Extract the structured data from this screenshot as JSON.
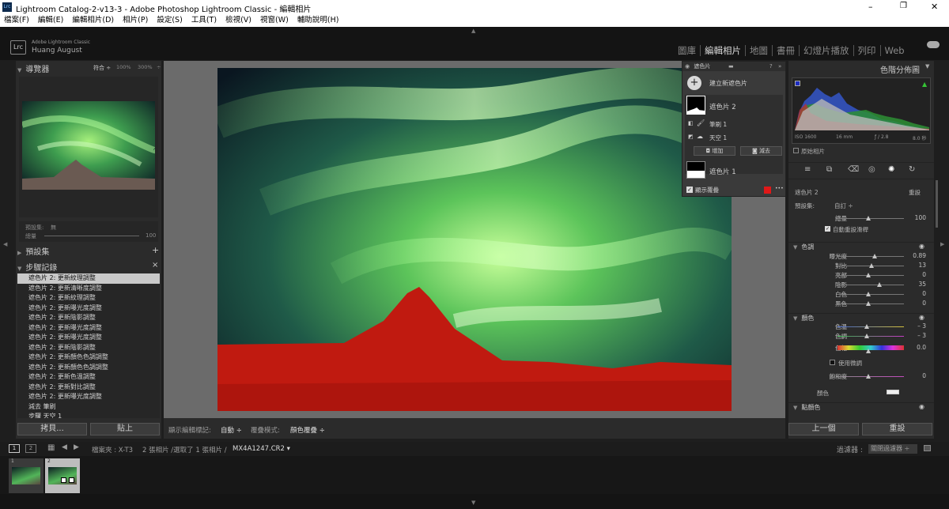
{
  "window": {
    "title": "Lightroom Catalog-2-v13-3 - Adobe Photoshop Lightroom Classic - 編輯相片",
    "icon": "Lrc",
    "controls": [
      "–",
      "❐",
      "✕"
    ]
  },
  "menu": [
    "檔案(F)",
    "編輯(E)",
    "編輯相片(D)",
    "相片(P)",
    "設定(S)",
    "工具(T)",
    "檢視(V)",
    "視窗(W)",
    "輔助說明(H)"
  ],
  "identity": {
    "badge": "Lrc",
    "product": "Adobe Lightroom Classic",
    "user": "Huang August"
  },
  "modules": [
    {
      "label": "圖庫",
      "active": false
    },
    {
      "label": "編輯相片",
      "active": true
    },
    {
      "label": "地圖",
      "active": false
    },
    {
      "label": "書冊",
      "active": false
    },
    {
      "label": "幻燈片播放",
      "active": false
    },
    {
      "label": "列印",
      "active": false
    },
    {
      "label": "Web",
      "active": false
    }
  ],
  "navigator": {
    "title": "導覽器",
    "zoom_fit": "符合 ÷",
    "zoom_100": "100%",
    "zoom_300": "300%"
  },
  "preset_preview": {
    "label": "預設集:",
    "value": "無",
    "amount_label": "總量",
    "amount_value": "100"
  },
  "presets": {
    "title": "預設集",
    "add": "+"
  },
  "history": {
    "title": "步驟記錄",
    "close": "×",
    "items": [
      "遮色片 2: 更新紋理調整",
      "遮色片 2: 更新清晰度調整",
      "遮色片 2: 更新紋理調整",
      "遮色片 2: 更新曝光度調整",
      "遮色片 2: 更新陰影調整",
      "遮色片 2: 更新曝光度調整",
      "遮色片 2: 更新曝光度調整",
      "遮色片 2: 更新陰影調整",
      "遮色片 2: 更新顏色色調調整",
      "遮色片 2: 更新顏色色調調整",
      "遮色片 2: 更新色溫調整",
      "遮色片 2: 更新對比調整",
      "遮色片 2: 更新曝光度調整",
      "減去 筆刷",
      "步驟 天空 1"
    ]
  },
  "left_buttons": {
    "copy": "拷貝...",
    "paste": "貼上"
  },
  "toolbar": {
    "show_label": "顯示編輯標記:",
    "show_value": "自動 ÷",
    "overlay_label": "覆疊模式:",
    "overlay_value": "顏色覆疊 ÷"
  },
  "mask_panel": {
    "title": "遮色片",
    "create": "建立新遮色片",
    "mask2": "遮色片 2",
    "brush": "筆刷 1",
    "sky": "天空 1",
    "add": "增加",
    "subtract": "減去",
    "mask1": "遮色片 1",
    "show_overlay": "顯示覆疊",
    "overlay_color": "#e01818",
    "more": "•••"
  },
  "histogram": {
    "title": "色階分佈圖",
    "iso": "ISO 1600",
    "focal": "16 mm",
    "aperture": "ƒ / 2.8",
    "shutter": "8.0 秒",
    "original": "原始相片"
  },
  "tools": [
    "sliders-icon",
    "crop-icon",
    "heal-icon",
    "redeye-icon",
    "mask-icon",
    "reset-icon"
  ],
  "mask_edit": {
    "name": "遮色片 2",
    "reset": "重設",
    "preset_label": "預設集:",
    "preset_value": "自訂 ÷",
    "amount_label": "總量",
    "amount_value": "100",
    "auto_reset": "自動重設滑桿"
  },
  "tone": {
    "title": "色調",
    "sliders": [
      {
        "label": "曝光度",
        "value": "0.89",
        "pos": 0.6
      },
      {
        "label": "對比",
        "value": "13",
        "pos": 0.56
      },
      {
        "label": "亮部",
        "value": "0",
        "pos": 0.5
      },
      {
        "label": "陰影",
        "value": "35",
        "pos": 0.67
      },
      {
        "label": "白色",
        "value": "0",
        "pos": 0.5
      },
      {
        "label": "黑色",
        "value": "0",
        "pos": 0.5
      }
    ]
  },
  "color": {
    "title": "顏色",
    "sliders": [
      {
        "label": "色溫",
        "value": "– 3",
        "pos": 0.48
      },
      {
        "label": "色調",
        "value": "– 3",
        "pos": 0.48
      },
      {
        "label": "色相",
        "value": "0.0",
        "pos": 0.5
      }
    ],
    "fine": "使用微調",
    "saturation_label": "飽和度",
    "saturation_value": "0",
    "color_label": "顏色"
  },
  "detail": {
    "title": "點顏色"
  },
  "right_buttons": {
    "prev": "上一個",
    "reset": "重設"
  },
  "filmbar": {
    "screen1": "1",
    "screen2": "2",
    "source": "檔案夾 : X-T3",
    "info": "2 張相片 /選取了 1 張相片 /",
    "file": "MX4A1247.CR2 ▾",
    "filter_label": "過濾器 :",
    "filter_value": "關閉過濾器 ÷"
  },
  "film_thumbs": [
    {
      "num": "1"
    },
    {
      "num": "2"
    }
  ]
}
